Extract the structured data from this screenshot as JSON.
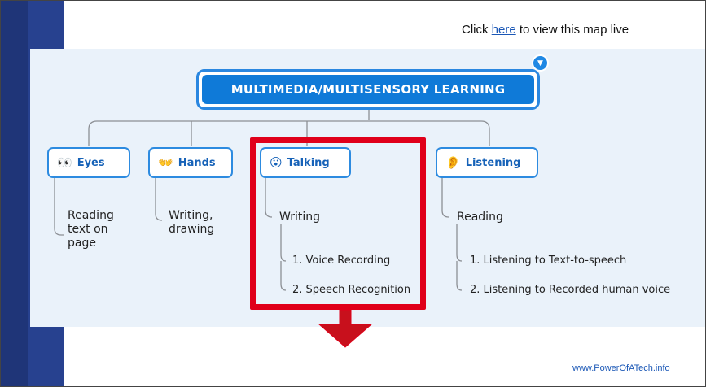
{
  "header": {
    "prefix": "Click ",
    "link": "here",
    "suffix": " to view this map live"
  },
  "root": {
    "label": "MULTIMEDIA/MULTISENSORY LEARNING"
  },
  "branches": [
    {
      "icon": "👀",
      "label": "Eyes",
      "items": [
        "Reading",
        "text on",
        "page"
      ]
    },
    {
      "icon": "👐",
      "label": "Hands",
      "items": [
        "Writing,",
        "drawing"
      ]
    },
    {
      "icon": "😮",
      "label": "Talking",
      "items": [
        "Writing"
      ],
      "subitems": [
        "1. Voice Recording",
        "2. Speech Recognition"
      ]
    },
    {
      "icon": "👂",
      "label": "Listening",
      "items": [
        "Reading"
      ],
      "subitems": [
        "1. Listening to Text-to-speech",
        "2. Listening to Recorded human voice"
      ]
    }
  ],
  "footer": {
    "link": "www.PowerOfATech.info"
  },
  "colors": {
    "accent": "#0f7ad8",
    "highlight": "#e0001a",
    "arrow": "#c8101c",
    "sidebar": "#27418f"
  }
}
